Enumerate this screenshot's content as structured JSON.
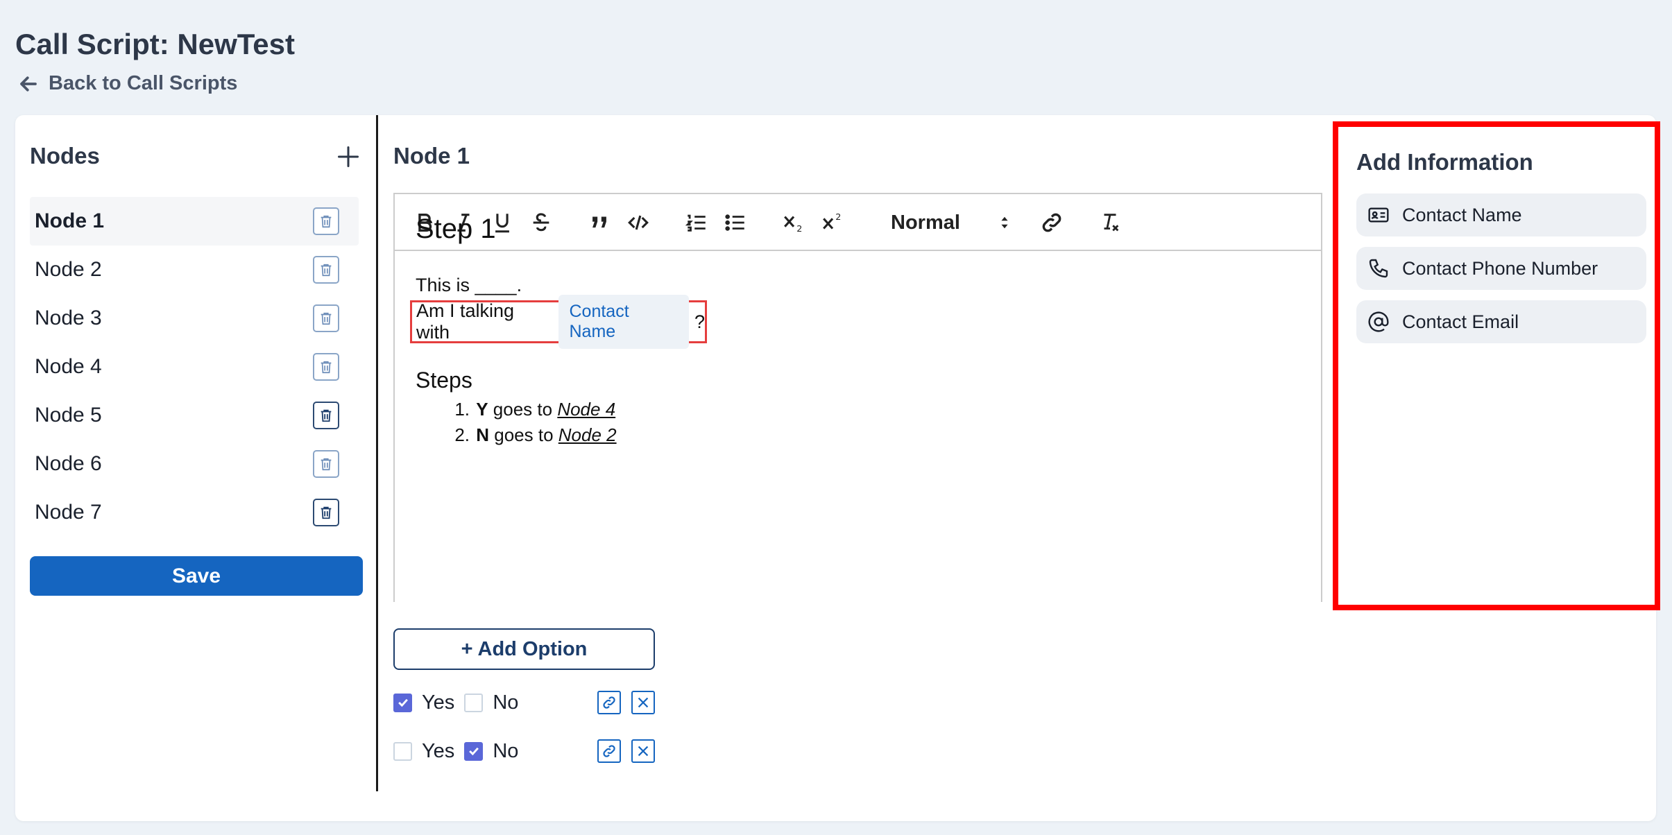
{
  "page": {
    "title": "Call Script: NewTest",
    "back_label": "Back to Call Scripts"
  },
  "nodes_panel": {
    "title": "Nodes",
    "items": [
      {
        "label": "Node 1",
        "active": true
      },
      {
        "label": "Node 2"
      },
      {
        "label": "Node 3"
      },
      {
        "label": "Node 4"
      },
      {
        "label": "Node 5"
      },
      {
        "label": "Node 6"
      },
      {
        "label": "Node 7"
      }
    ],
    "save_label": "Save"
  },
  "editor": {
    "heading": "Node 1",
    "toolbar": {
      "format_value": "Normal"
    },
    "content": {
      "h1": "Step 1",
      "line1": "This is ____.",
      "line2_prefix": "Am I talking with",
      "chip": "Contact Name",
      "line2_suffix": "?",
      "h3": "Steps",
      "steps": [
        {
          "num": "1.",
          "key": "Y",
          "text": " goes to ",
          "link": "Node 4"
        },
        {
          "num": "2.",
          "key": "N",
          "text": " goes to ",
          "link": "Node 2"
        }
      ]
    }
  },
  "options": {
    "add_label": "+ Add Option",
    "rows": [
      {
        "yes_label": "Yes",
        "no_label": "No",
        "yes_checked": true,
        "no_checked": false
      },
      {
        "yes_label": "Yes",
        "no_label": "No",
        "yes_checked": false,
        "no_checked": true
      }
    ]
  },
  "info_panel": {
    "title": "Add Information",
    "items": [
      {
        "label": "Contact Name",
        "icon": "contact-card-icon"
      },
      {
        "label": "Contact Phone Number",
        "icon": "phone-icon"
      },
      {
        "label": "Contact Email",
        "icon": "at-sign-icon"
      }
    ]
  },
  "colors": {
    "primary": "#1565c0",
    "highlight_border": "#ff0000",
    "checkbox_checked": "#5a67d8"
  }
}
